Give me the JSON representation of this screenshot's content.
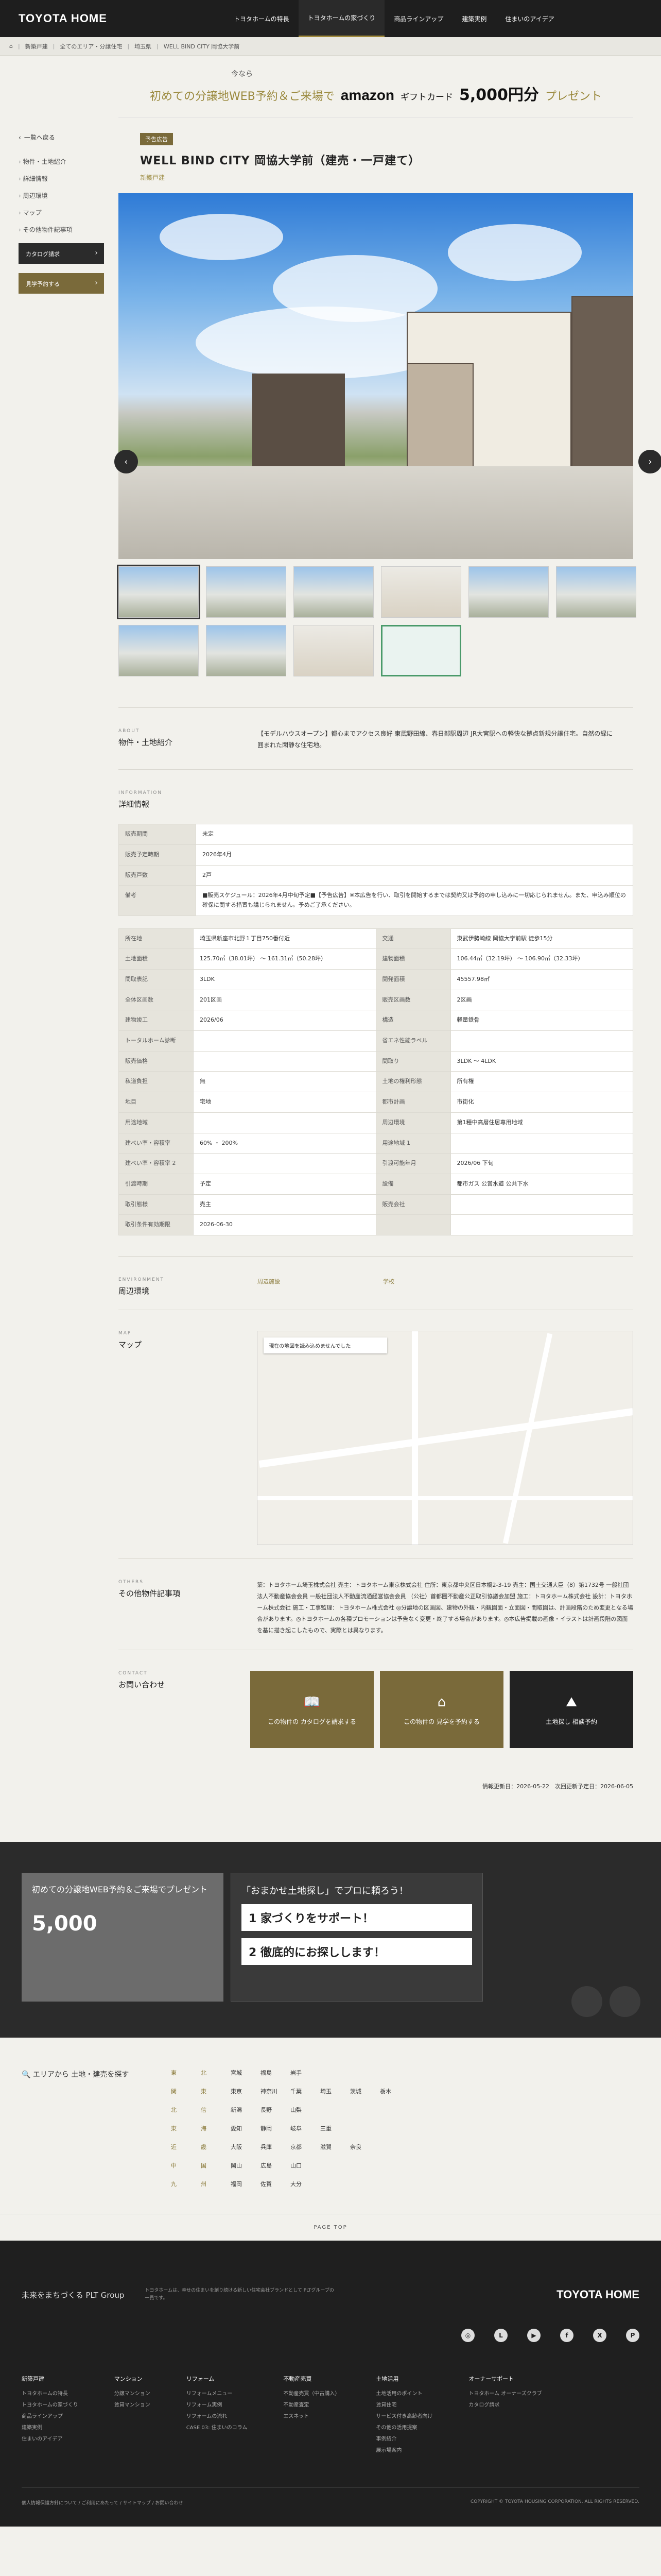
{
  "header": {
    "logo": "TOYOTA HOME",
    "nav": [
      "トヨタホームの特長",
      "トヨタホームの家づくり",
      "商品ラインアップ",
      "建築実例",
      "住まいのアイデア"
    ]
  },
  "breadcrumb": [
    "⌂",
    "新築戸建",
    "全てのエリア・分譲住宅",
    "埼玉県",
    "WELL BIND CITY 岡協大学前"
  ],
  "side": {
    "back": "一覧へ戻る",
    "items": [
      "物件・土地紹介",
      "詳細情報",
      "周辺環境",
      "マップ",
      "その他物件記事項"
    ],
    "catalog": "カタログ請求",
    "visit": "見学予約する"
  },
  "banner": {
    "now": "今なら",
    "lead": "初めての分譲地WEB予約＆ご来場で",
    "amazon": "amazon",
    "gift": "ギフトカード",
    "amount": "5,000円分",
    "tail": "プレゼント"
  },
  "property": {
    "badge": "予告広告",
    "title": "WELL BIND CITY 岡協大学前（建売・一戸建て）",
    "type": "新築戸建"
  },
  "intro": {
    "en": "ABOUT",
    "jp": "物件・土地紹介",
    "text": "【モデルハウスオープン】都心までアクセス良好 東武野田線、春日部駅周辺 JR大宮駅への軽快な拠点新規分譲住宅。自然の緑に囲まれた閑静な住宅地。"
  },
  "info": {
    "en": "INFORMATION",
    "jp": "詳細情報",
    "summary": [
      [
        "販売期間",
        "未定"
      ],
      [
        "販売予定時期",
        "2026年4月"
      ],
      [
        "販売戸数",
        "2戸"
      ],
      [
        "備考",
        "■販売スケジュール：2026年4月中旬予定■【予告広告】※本広告を行い、取引を開始するまでは契約又は予約の申し込みに一切応じられません。また、申込み順位の確保に関する措置も講じられません。予めご了承ください。"
      ]
    ],
    "detail": [
      [
        "所在地",
        "埼玉県新座市北野１丁目750番付近",
        "交通",
        "東武伊勢崎線 岡協大学前駅 徒歩15分"
      ],
      [
        "土地面積",
        "125.70㎡（38.01坪） 〜 161.31㎡（50.28坪）",
        "建物面積",
        "106.44㎡（32.19坪） 〜 106.90㎡（32.33坪）"
      ],
      [
        "間取表記",
        "3LDK",
        "開発面積",
        "45557.98㎡"
      ],
      [
        "全体区画数",
        "201区画",
        "販売区画数",
        "2区画"
      ],
      [
        "建物竣工",
        "2026/06",
        "構造",
        "軽量鉄骨"
      ],
      [
        "トータルホーム診断",
        "",
        "省エネ性能ラベル",
        ""
      ],
      [
        "販売価格",
        "",
        "間取り",
        "3LDK 〜 4LDK"
      ],
      [
        "私道負担",
        "無",
        "土地の権利形態",
        "所有権"
      ],
      [
        "地目",
        "宅地",
        "都市計画",
        "市街化"
      ],
      [
        "用途地域",
        "",
        "周辺環境",
        "第1種中高層住居専用地域"
      ],
      [
        "建ぺい率・容積率",
        "60% ・ 200%",
        "用途地域 1",
        ""
      ],
      [
        "建ぺい率・容積率 2",
        "",
        "引渡可能年月",
        "2026/06 下旬"
      ],
      [
        "引渡時期",
        "予定",
        "設備",
        "都市ガス 公営水道 公共下水"
      ],
      [
        "取引態様",
        "売主",
        "販売会社",
        ""
      ],
      [
        "取引条件有効期限",
        "2026-06-30",
        "",
        ""
      ]
    ]
  },
  "surround": {
    "en": "ENVIRONMENT",
    "jp": "周辺環境",
    "items": [
      "周辺施設",
      "学校"
    ]
  },
  "map": {
    "en": "MAP",
    "jp": "マップ",
    "msg": "現在の地図を読み込めませんでした"
  },
  "other": {
    "en": "OTHERS",
    "jp": "その他物件記事項",
    "text": "築：トヨタホーム埼玉株式会社 売主：トヨタホーム東京株式会社 住所：東京都中央区日本橋2-3-19 売主：国土交通大臣（8）第1732号 一般社団法人不動産協会会員 一般社団法人不動産流通経営協会会員 （公社）首都圏不動産公正取引協議会加盟 施工：トヨタホーム株式会社 設計：トヨタホーム株式会社 施工・工事監理：トヨタホーム株式会社 ◎分譲地の区画図、建物の外観・内観図面・立面図・間取図は、計画段階のため変更となる場合があります。◎トヨタホームの各種プロモーションは予告なく変更・終了する場合があります。◎本広告掲載の画像・イラストは計画段階の図面を基に描き起こしたもので、実際とは異なります。"
  },
  "contact": {
    "en": "CONTACT",
    "jp": "お問い合わせ",
    "btn1": "この物件の カタログを請求する",
    "btn2": "この物件の 見学を予約する",
    "btn3": "土地探し 相談予約"
  },
  "dates": {
    "updated": "情報更新日：2026-05-22",
    "next": "次回更新予定日：2026-06-05"
  },
  "bottom": {
    "b1": "初めての分譲地WEB予約＆ご来場でプレゼント",
    "b1amt": "5,000",
    "b2": "「おまかせ土地探し」でプロに頼ろう！",
    "b2r1": "1 家づくりをサポート！",
    "b2r2": "2 徹底的にお探しします！"
  },
  "area": {
    "head": "エリアから 土地・建売を探す",
    "cells": [
      "東",
      "北",
      "宮城",
      "福島",
      "岩手",
      "",
      "",
      "",
      "関",
      "東",
      "東京",
      "神奈川",
      "千葉",
      "埼玉",
      "茨城",
      "栃木",
      "北",
      "信",
      "新潟",
      "長野",
      "山梨",
      "",
      "",
      "",
      "東",
      "海",
      "愛知",
      "静岡",
      "岐阜",
      "三重",
      "",
      "",
      "近",
      "畿",
      "大阪",
      "兵庫",
      "京都",
      "滋賀",
      "奈良",
      "",
      "中",
      "国",
      "岡山",
      "広島",
      "山口",
      "",
      "",
      "",
      "九",
      "州",
      "福岡",
      "佐賀",
      "大分",
      "",
      "",
      ""
    ]
  },
  "pagetop": "PAGE TOP",
  "footer": {
    "plt": "未来をまちづくる PLT Group",
    "desc": "トヨタホームは、幸せの住まいを創り続ける新しい住宅会社ブランドとして PLTグループの一員です。",
    "logo": "TOYOTA HOME",
    "cols": [
      [
        "新築戸建",
        "トヨタホームの特長",
        "トヨタホームの家づくり",
        "商品ラインアップ",
        "建築実例",
        "住まいのアイデア"
      ],
      [
        "マンション",
        "分譲マンション",
        "賃貸マンション"
      ],
      [
        "リフォーム",
        "リフォームメニュー",
        "リフォーム実例",
        "リフォームの流れ",
        "CASE 03: 住まいのコラム"
      ],
      [
        "不動産売買",
        "不動産売買（中古購入）",
        "不動産査定",
        "エスネット"
      ],
      [
        "土地活用",
        "土地活用のポイント",
        "賃貸住宅",
        "サービス付き高齢者向け",
        "その他の活用提案",
        "事例紹介",
        "展示場案内"
      ],
      [
        "オーナーサポート",
        "トヨタホーム オーナーズクラブ",
        "カタログ請求"
      ]
    ],
    "copy_l": "個人情報保護方針について / ご利用にあたって / サイトマップ / お問い合わせ",
    "copy_r": "COPYRIGHT © TOYOTA HOUSING CORPORATION. ALL RIGHTS RESERVED."
  },
  "colors": {
    "gold": "#7a6a3a",
    "dark": "#1e1e1e"
  }
}
